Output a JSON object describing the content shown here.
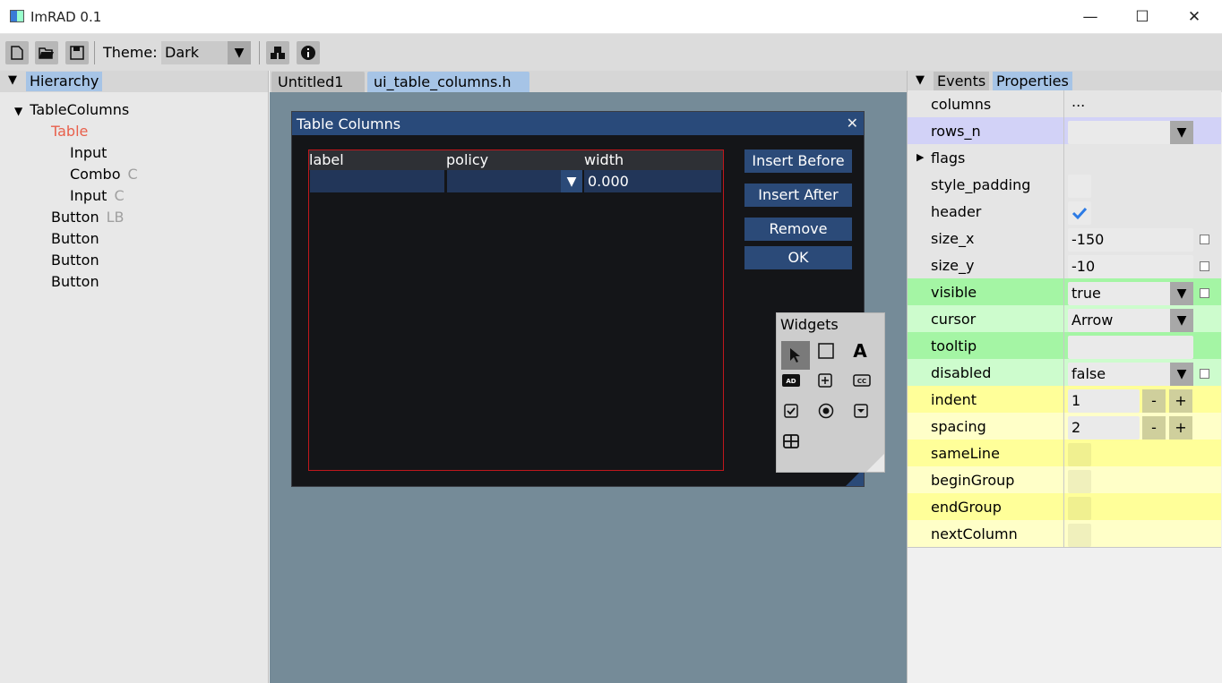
{
  "window": {
    "title": "ImRAD 0.1"
  },
  "toolbar": {
    "theme_label": "Theme:",
    "theme_value": "Dark"
  },
  "hierarchy": {
    "tab": "Hierarchy",
    "items": [
      {
        "label": "TableColumns",
        "hint": ""
      },
      {
        "label": "Table",
        "hint": ""
      },
      {
        "label": "Input",
        "hint": ""
      },
      {
        "label": "Combo",
        "hint": "C"
      },
      {
        "label": "Input",
        "hint": "C"
      },
      {
        "label": "Button",
        "hint": "LB"
      },
      {
        "label": "Button",
        "hint": ""
      },
      {
        "label": "Button",
        "hint": ""
      },
      {
        "label": "Button",
        "hint": ""
      }
    ]
  },
  "tabs": [
    "Untitled1",
    "ui_table_columns.h"
  ],
  "dialog": {
    "title": "Table Columns",
    "columns": [
      "label",
      "policy",
      "width"
    ],
    "width_value": "0.000",
    "buttons": [
      "Insert Before",
      "Insert After",
      "Remove",
      "OK"
    ]
  },
  "widgets": {
    "title": "Widgets"
  },
  "right_panel": {
    "tabs": [
      "Events",
      "Properties"
    ],
    "properties": [
      {
        "name": "columns",
        "value": "..."
      },
      {
        "name": "rows_n",
        "value": ""
      },
      {
        "name": "flags",
        "value": ""
      },
      {
        "name": "style_padding",
        "value": ""
      },
      {
        "name": "header",
        "value": ""
      },
      {
        "name": "size_x",
        "value": "-150"
      },
      {
        "name": "size_y",
        "value": "-10"
      },
      {
        "name": "visible",
        "value": "true"
      },
      {
        "name": "cursor",
        "value": "Arrow"
      },
      {
        "name": "tooltip",
        "value": ""
      },
      {
        "name": "disabled",
        "value": "false"
      },
      {
        "name": "indent",
        "value": "1"
      },
      {
        "name": "spacing",
        "value": "2"
      },
      {
        "name": "sameLine",
        "value": ""
      },
      {
        "name": "beginGroup",
        "value": ""
      },
      {
        "name": "endGroup",
        "value": ""
      },
      {
        "name": "nextColumn",
        "value": ""
      }
    ],
    "stepper_minus": "-",
    "stepper_plus": "+"
  },
  "colors": {
    "accent_blue": "#294a7a",
    "selected_tree_item": "#e8604c",
    "row_blue": "#d2d2f7",
    "row_green": "#a4f5a4",
    "row_yellow": "#ffff99"
  }
}
